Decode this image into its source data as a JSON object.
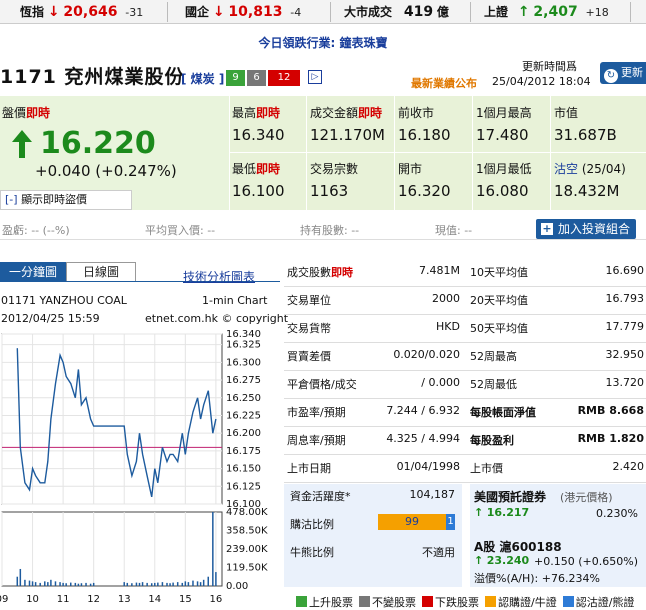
{
  "ticker": {
    "hsi": {
      "label": "恆指",
      "value": "20,646",
      "change": "-31"
    },
    "hscei": {
      "label": "國企",
      "value": "10,813",
      "change": "-4"
    },
    "turnover": {
      "label": "大市成交",
      "value": "419",
      "unit": "億"
    },
    "sse": {
      "label": "上證",
      "value": "2,407",
      "change": "+18"
    }
  },
  "leader": {
    "label": "今日領跌行業:",
    "value": "鐘表珠寶"
  },
  "stock": {
    "code": "1171",
    "name": "兗州煤業股份",
    "sector": "[ 煤炭 ]",
    "badges": [
      {
        "text": "9",
        "color": "#3aa33a"
      },
      {
        "text": "6",
        "color": "#777777"
      },
      {
        "text": "12",
        "color": "#d40000"
      }
    ],
    "update_label": "更新時間爲",
    "result_label": "最新業績公布",
    "update_time": "25/04/2012 18:04",
    "refresh_label": "更新"
  },
  "quote": {
    "price_label": "盤價",
    "price_flag": "即時",
    "price": "16.220",
    "change": "+0.040 (+0.247%)",
    "show_realtime": "顯示即時盜價",
    "high_label": "最高",
    "high_flag": "即時",
    "high": "16.340",
    "low_label": "最低",
    "low_flag": "即時",
    "low": "16.100",
    "turnover_label": "成交金額",
    "turnover_flag": "即時",
    "turnover": "121.170M",
    "trades_label": "交易宗數",
    "trades": "1163",
    "prev_label": "前收市",
    "prev": "16.180",
    "open_label": "開市",
    "open": "16.320",
    "m1high_label": "1個月最高",
    "m1high": "17.480",
    "m1low_label": "1個月最低",
    "m1low": "16.080",
    "mcap_label": "市值",
    "mcap": "31.687B",
    "short_label": "沽空",
    "short_date": "(25/04)",
    "short": "18.432M"
  },
  "holdings": {
    "pl": "盈虧: -- (--%)",
    "avg": "平均買入價: --",
    "qty": "持有股數: --",
    "cur": "現值: --",
    "add_label": "加入投資組合"
  },
  "chart_tabs": {
    "tab1": "一分鐘圖",
    "tab2": "日線圖",
    "tech": "技術分析圖表"
  },
  "chart_header": {
    "code": "01171 YANZHOU COAL",
    "interval": "1-min Chart",
    "date": "2012/04/25 15:59",
    "copyright": "etnet.com.hk © copyright"
  },
  "chart_data": {
    "type": "line",
    "title": "01171 YANZHOU COAL",
    "price_ticks": [
      "16.340",
      "16.325",
      "16.300",
      "16.275",
      "16.250",
      "16.225",
      "16.200",
      "16.175",
      "16.150",
      "16.125",
      "16.100"
    ],
    "volume_ticks": [
      "478.00K",
      "358.50K",
      "239.00K",
      "119.50K",
      "0.00"
    ],
    "x_ticks": [
      "09",
      "10",
      "11",
      "12",
      "13",
      "14",
      "15",
      "16"
    ],
    "ylim": [
      16.1,
      16.34
    ],
    "prev_close": 16.18,
    "x": [
      9.5,
      9.6,
      9.75,
      9.9,
      10.0,
      10.1,
      10.25,
      10.4,
      10.5,
      10.6,
      10.75,
      10.9,
      11.0,
      11.1,
      11.25,
      11.4,
      11.5,
      11.6,
      11.75,
      11.9,
      12.0,
      13.0,
      13.1,
      13.25,
      13.4,
      13.5,
      13.6,
      13.75,
      13.9,
      14.0,
      14.1,
      14.25,
      14.4,
      14.5,
      14.6,
      14.75,
      14.9,
      15.0,
      15.1,
      15.25,
      15.4,
      15.5,
      15.6,
      15.75,
      15.9,
      16.0
    ],
    "price": [
      16.32,
      16.18,
      16.13,
      16.12,
      16.15,
      16.14,
      16.13,
      16.13,
      16.16,
      16.22,
      16.27,
      16.31,
      16.3,
      16.28,
      16.27,
      16.25,
      16.29,
      16.24,
      16.25,
      16.22,
      16.21,
      16.21,
      16.17,
      16.14,
      16.16,
      16.2,
      16.17,
      16.14,
      16.11,
      16.15,
      16.13,
      16.18,
      16.16,
      16.17,
      16.17,
      16.16,
      16.2,
      16.17,
      16.2,
      16.23,
      16.25,
      16.22,
      16.24,
      16.26,
      16.2,
      16.22
    ],
    "volume": [
      60,
      110,
      40,
      35,
      30,
      25,
      20,
      30,
      25,
      40,
      30,
      25,
      20,
      18,
      22,
      20,
      15,
      18,
      20,
      15,
      20,
      25,
      20,
      18,
      22,
      20,
      25,
      20,
      18,
      20,
      22,
      25,
      20,
      18,
      22,
      25,
      20,
      30,
      25,
      35,
      30,
      25,
      40,
      60,
      478,
      90
    ]
  },
  "stats_left": [
    {
      "label": "成交股數",
      "flag": "即時",
      "value": "7.481M"
    },
    {
      "label": "交易單位",
      "value": "2000"
    },
    {
      "label": "交易貨幣",
      "value": "HKD"
    },
    {
      "label": "買賣差價",
      "value": "0.020/0.020"
    },
    {
      "label": "平倉價格/成交",
      "value": "/ 0.000"
    },
    {
      "label": "市盈率/預期",
      "value": "7.244 / 6.932"
    },
    {
      "label": "周息率/預期",
      "value": "4.325 / 4.994"
    },
    {
      "label": "上市日期",
      "value": "01/04/1998"
    }
  ],
  "stats_right": [
    {
      "label": "10天平均值",
      "value": "16.690"
    },
    {
      "label": "20天平均值",
      "value": "16.793"
    },
    {
      "label": "50天平均值",
      "value": "17.779"
    },
    {
      "label": "52周最高",
      "value": "32.950"
    },
    {
      "label": "52周最低",
      "value": "13.720"
    },
    {
      "label": "每股帳面淨值",
      "value": "RMB 8.668"
    },
    {
      "label": "每股盈利",
      "value": "RMB 1.820"
    },
    {
      "label": "上市價",
      "value": "2.420"
    }
  ],
  "sentiment": {
    "activity_label": "資金活躍度*",
    "activity": "104,187",
    "ratio_label": "購沽比例",
    "ratio_buy": "99",
    "ratio_sell": "1",
    "bull_label": "牛熊比例",
    "bull": "不適用"
  },
  "warrant": {
    "title": "美國預託證券",
    "sub": "(港元價格)",
    "price": "16.217",
    "pct": "0.230%",
    "a_label": "A股",
    "a_code": "滬600188",
    "a_price": "23.240",
    "a_change": "+0.150 (+0.650%)",
    "premium": "溢價%(A/H): +76.234%"
  },
  "legend": [
    {
      "text": "上升股票",
      "color": "#3aa33a"
    },
    {
      "text": "不變股票",
      "color": "#777777"
    },
    {
      "text": "下跌股票",
      "color": "#d40000"
    },
    {
      "text": "認購證/牛證",
      "color": "#f5a000"
    },
    {
      "text": "認沽證/熊證",
      "color": "#2e7bd6"
    }
  ]
}
